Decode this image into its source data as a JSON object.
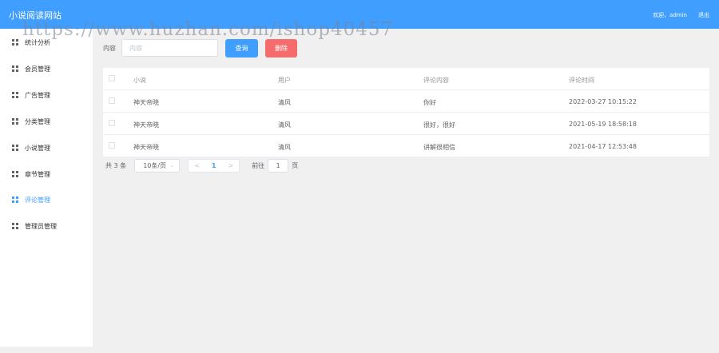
{
  "header": {
    "app_title": "小说阅读网站",
    "welcome": "欢迎，admin",
    "logout": "退出"
  },
  "watermark": "https://www.huzhan.com/ishop40457",
  "sidebar": {
    "items": [
      {
        "label": "统计分析",
        "icon": "grid-icon",
        "active": false
      },
      {
        "label": "会员管理",
        "icon": "grid-icon",
        "active": false
      },
      {
        "label": "广告管理",
        "icon": "grid-icon",
        "active": false
      },
      {
        "label": "分类管理",
        "icon": "grid-icon",
        "active": false
      },
      {
        "label": "小说管理",
        "icon": "grid-icon",
        "active": false
      },
      {
        "label": "章节管理",
        "icon": "grid-icon",
        "active": false
      },
      {
        "label": "评论管理",
        "icon": "grid-icon",
        "active": true
      },
      {
        "label": "管理员管理",
        "icon": "grid-icon",
        "active": false
      }
    ],
    "active_color": "#409eff"
  },
  "search": {
    "label": "内容",
    "value": "",
    "placeholder": "内容",
    "query_button": "查询",
    "delete_button": "删除"
  },
  "table": {
    "columns": [
      "小说",
      "用户",
      "评论内容",
      "评论时间"
    ],
    "rows": [
      [
        "神天帝晓",
        "清风",
        "你好",
        "2022-03-27 10:15:22"
      ],
      [
        "神天帝晓",
        "清风",
        "很好，很好",
        "2021-05-19 18:58:18"
      ],
      [
        "神天帝晓",
        "清风",
        "讲解很相信",
        "2021-04-17 12:53:48"
      ]
    ]
  },
  "pagination": {
    "total": "共 3 条",
    "page_size": "10条/页",
    "current_page": "1",
    "goto_label": "前往",
    "goto_value": "1",
    "page_suffix": "页"
  },
  "colors": {
    "primary": "#409eff",
    "danger": "#f56c6c"
  }
}
